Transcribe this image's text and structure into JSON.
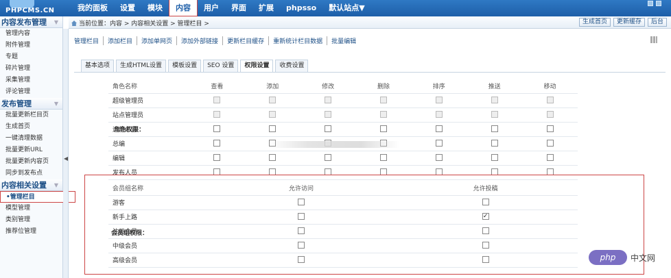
{
  "logo": {
    "text": "PHPCMS.CN"
  },
  "nav": {
    "items": [
      "我的面板",
      "设置",
      "模块",
      "内容",
      "用户",
      "界面",
      "扩展",
      "phpsso"
    ],
    "active": "内容",
    "site_select": "默认站点▼"
  },
  "breadcrumb": "当前位置：内容 > 内容相关设置 > 管理栏目 >",
  "sub_buttons": [
    "生成首页",
    "更新缓存",
    "后台"
  ],
  "sidebar": {
    "sections": [
      {
        "title": "内容发布管理",
        "items": [
          "管理内容",
          "附件管理",
          "专题",
          "碎片管理",
          "采集管理",
          "评论管理"
        ]
      },
      {
        "title": "发布管理",
        "items": [
          "批量更新栏目页",
          "生成首页",
          "一键清理数据",
          "批量更新URL",
          "批量更新内容页",
          "同步到发布点"
        ]
      },
      {
        "title": "内容相关设置",
        "items": [
          "•管理栏目",
          "模型管理",
          "类别管理",
          "推荐位管理"
        ]
      }
    ],
    "active_item": "•管理栏目"
  },
  "actions": [
    "管理栏目",
    "添加栏目",
    "添加单网页",
    "添加外部链接",
    "更新栏目缓存",
    "重新统计栏目数据",
    "批量编辑"
  ],
  "tabs": [
    "基本选项",
    "生成HTML设置",
    "模板设置",
    "SEO 设置",
    "权限设置",
    "收费设置"
  ],
  "active_tab": "权限设置",
  "role_section": {
    "label": "角色权限：",
    "columns": [
      "角色名称",
      "查看",
      "添加",
      "修改",
      "删除",
      "排序",
      "推送",
      "移动"
    ],
    "rows": [
      {
        "name": "超级管理员",
        "disabled": true
      },
      {
        "name": "站点管理员",
        "disabled": true
      },
      {
        "name": "运营总监",
        "disabled": false
      },
      {
        "name": "总编",
        "disabled": false
      },
      {
        "name": "编辑",
        "disabled": false
      },
      {
        "name": "发布人员",
        "disabled": false
      }
    ]
  },
  "member_section": {
    "label": "会员组权限：",
    "columns": [
      "会员组名称",
      "允许访问",
      "允许投稿"
    ],
    "rows": [
      {
        "name": "游客",
        "visit": false,
        "submit": false
      },
      {
        "name": "新手上路",
        "visit": false,
        "submit": true
      },
      {
        "name": "注册会员",
        "visit": false,
        "submit": false
      },
      {
        "name": "中级会员",
        "visit": false,
        "submit": false
      },
      {
        "name": "高级会员",
        "visit": false,
        "submit": false
      }
    ]
  },
  "watermark": {
    "badge": "php",
    "text": "中文网"
  }
}
